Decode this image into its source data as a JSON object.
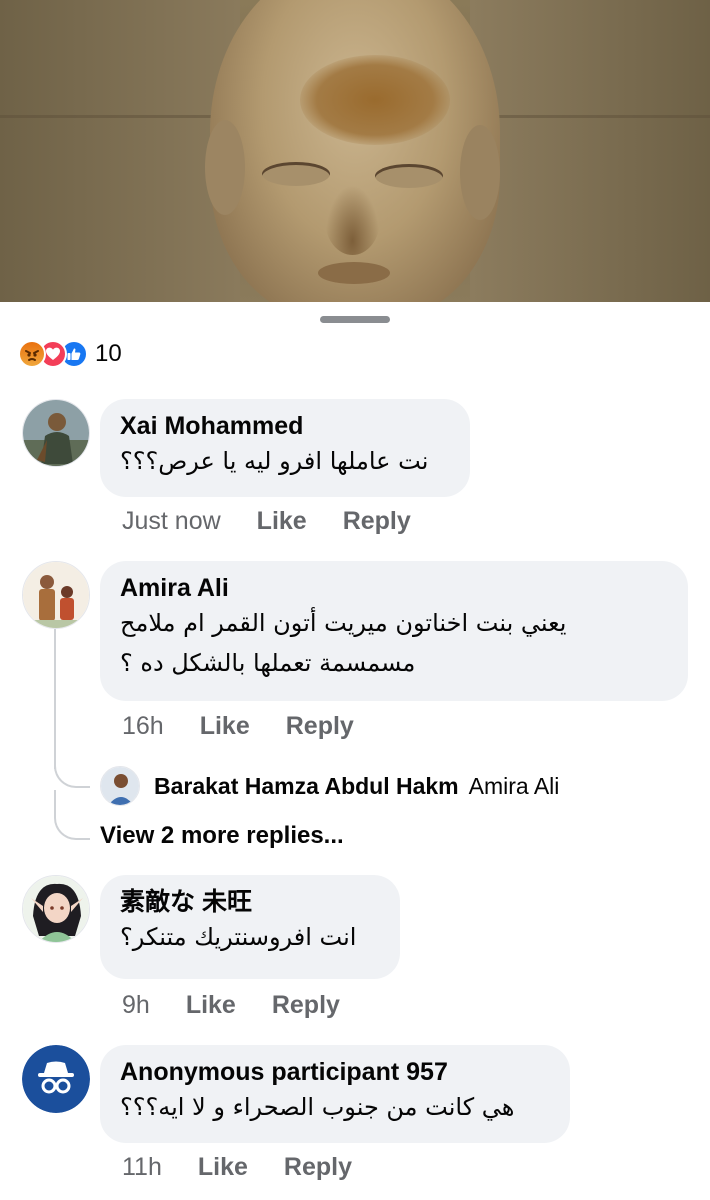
{
  "reactions": {
    "icons": [
      "angry-icon",
      "love-icon",
      "like-icon"
    ],
    "count": "10"
  },
  "comments": [
    {
      "name": "Xai Mohammed",
      "text": "نت عاملها افرو ليه يا عرص؟؟؟",
      "time": "Just now",
      "like": "Like",
      "reply": "Reply"
    },
    {
      "name": "Amira Ali",
      "text_line1": "يعني بنت اخناتون ميريت أتون القمر ام ملامح",
      "text_line2": "مسمسمة تعملها بالشكل ده ؟",
      "time": "16h",
      "like": "Like",
      "reply": "Reply",
      "reply_preview": {
        "name": "Barakat Hamza Abdul Hakm",
        "tag": "Amira Ali"
      },
      "more_replies": "View 2 more replies..."
    },
    {
      "name": "素敵な 未旺",
      "text": "انت افروسنتريك متنكر؟",
      "time": "9h",
      "like": "Like",
      "reply": "Reply"
    },
    {
      "name": "Anonymous participant 957",
      "text": "هي كانت من جنوب الصحراء و لا ايه؟؟؟",
      "time": "11h",
      "like": "Like",
      "reply": "Reply"
    }
  ],
  "colors": {
    "bubble": "#f0f2f5",
    "meta_text": "#65676b",
    "like_blue": "#1877f2",
    "love_red": "#f33e58",
    "angry_orange": "#e9710f",
    "anon_blue": "#1b4f9c"
  }
}
